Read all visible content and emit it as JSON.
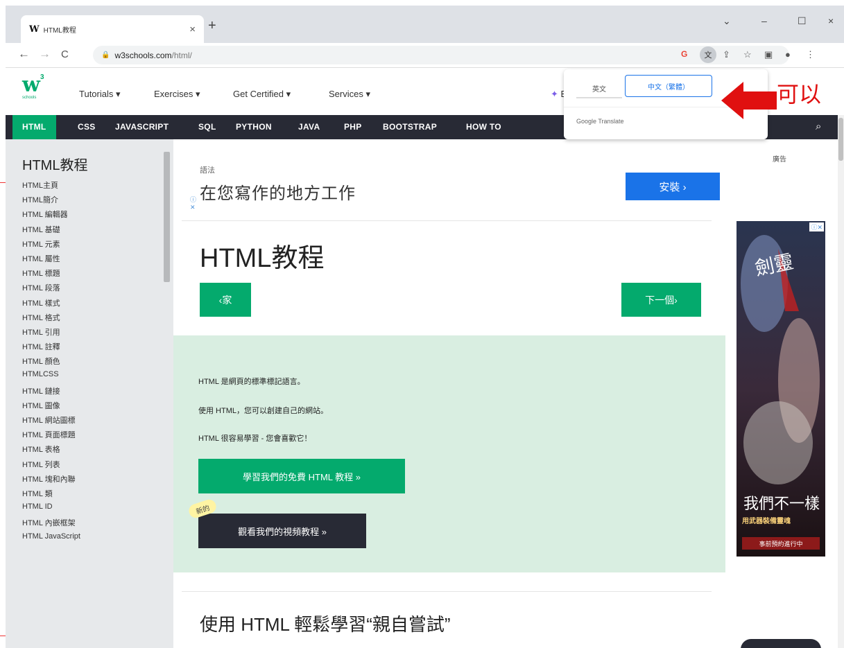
{
  "browser": {
    "tab_favicon": "W",
    "tab_title": "HTML教程",
    "tab_close": "×",
    "new_tab": "+",
    "nav": {
      "back": "←",
      "forward": "→",
      "reload": "C"
    },
    "url_host": "w3schools.com",
    "url_path": "/html/",
    "window": {
      "minimize": "–",
      "maximize": "☐",
      "close": "×",
      "dropdown": "⌄"
    },
    "toolbar_icons": [
      "google-icon",
      "translate-icon",
      "share-icon",
      "star-icon",
      "sidepanel-icon",
      "profile-icon",
      "menu-icon"
    ]
  },
  "w3": {
    "logo_main": "w",
    "logo_sup": "3",
    "logo_sub": "schools",
    "menu": [
      "Tutorials ▾",
      "Exercises ▾",
      "Get Certified ▾",
      "Services ▾"
    ],
    "books": "Boo"
  },
  "topnav": {
    "items": [
      "HTML",
      "CSS",
      "JAVASCRIPT",
      "SQL",
      "PYTHON",
      "JAVA",
      "PHP",
      "BOOTSTRAP",
      "HOW TO"
    ],
    "active": "HTML"
  },
  "sidebar": {
    "title": "HTML教程",
    "links": [
      "HTML主頁",
      "HTML簡介",
      "HTML 編輯器",
      "HTML 基礎",
      "HTML 元素",
      "HTML 屬性",
      "HTML 標題",
      "HTML 段落",
      "HTML 樣式",
      "HTML 格式",
      "HTML 引用",
      "HTML 註釋",
      "HTML 顏色",
      "HTMLCSS",
      "HTML 鏈接",
      "HTML 圖像",
      "HTML 網站圖標",
      "HTML 頁面標題",
      "HTML 表格",
      "HTML 列表",
      "HTML 塊和內聯",
      "HTML 類",
      "HTML ID",
      "HTML 內嵌框架",
      "HTML JavaScript"
    ]
  },
  "main": {
    "ad_tag": "語法",
    "ad_headline": "在您寫作的地方工作",
    "ad_button": "安裝 ›",
    "page_title": "HTML教程",
    "prev_button": "‹家",
    "next_button": "下一個›",
    "intro_lines": [
      "HTML 是網頁的標準標記語言。",
      "使用 HTML，您可以創建自己的網站。",
      "HTML 很容易學習 - 您會喜歡它！"
    ],
    "learn_button": "學習我們的免費 HTML 教程 »",
    "new_badge": "新的",
    "video_button": "觀看我們的視頻教程 »",
    "section_title": "使用 HTML 輕鬆學習“親自嘗試”"
  },
  "right": {
    "ad_label": "廣告",
    "banner_texts": [
      "劍靈",
      "我們不一樣",
      "用武器裝備靈魂",
      "事前預約進行中"
    ]
  },
  "translate": {
    "lang_source": "英文",
    "lang_target": "中文（繁體）",
    "provider": "Google Translate"
  },
  "annotation": {
    "text": "可以",
    "color": "#e01010"
  },
  "colors": {
    "accent": "#04AA6D",
    "nav_dark": "#282A35",
    "sidebar_bg": "#E7E9EB",
    "intro_bg": "#D9EEE1"
  }
}
